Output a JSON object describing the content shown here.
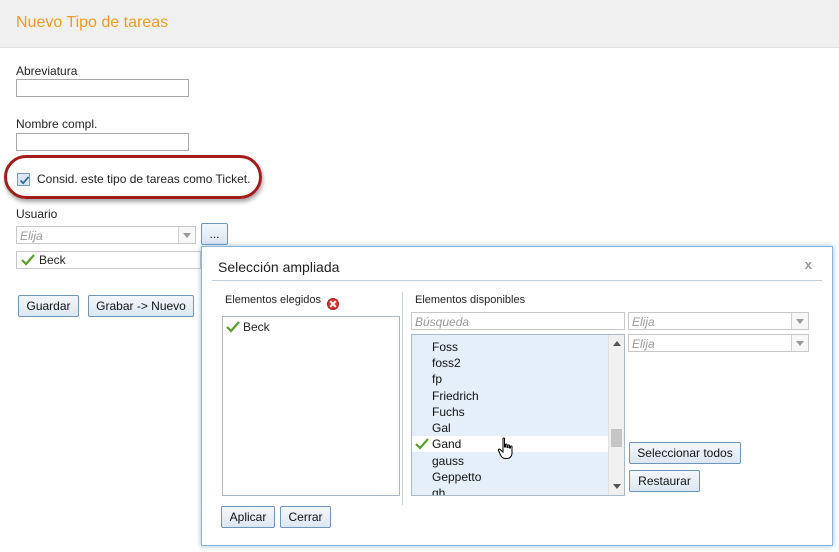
{
  "header": {
    "title": "Nuevo Tipo de tareas"
  },
  "form": {
    "abbreviation_label": "Abreviatura",
    "abbreviation_value": "",
    "fullname_label": "Nombre compl.",
    "fullname_value": "",
    "ticket_checkbox_label": "Consid. este tipo de tareas como Ticket.",
    "ticket_checkbox_checked": true,
    "user_label": "Usuario",
    "user_select_placeholder": "Elija",
    "more_button": "...",
    "selected_user": "Beck",
    "save_button": "Guardar",
    "save_new_button": "Grabar -> Nuevo"
  },
  "dialog": {
    "title": "Selección ampliada",
    "close": "x",
    "chosen_label": "Elementos elegidos",
    "chosen_items": [
      "Beck"
    ],
    "available_label": "Elementos disponibles",
    "search_placeholder": "Búsqueda",
    "filter1_placeholder": "Elija",
    "filter2_placeholder": "Elija",
    "available_items": [
      "Foss",
      "foss2",
      "fp",
      "Friedrich",
      "Fuchs",
      "Gal",
      "Gand",
      "gauss",
      "Geppetto",
      "gh"
    ],
    "checked_item": "Gand",
    "select_all_button": "Seleccionar todos",
    "restore_button": "Restaurar",
    "apply_button": "Aplicar",
    "close_button": "Cerrar"
  },
  "colors": {
    "title_orange": "#f39a1e",
    "highlight_red": "#a41c1c",
    "check_green": "#5aa02c",
    "list_blue": "#e4eff9"
  }
}
